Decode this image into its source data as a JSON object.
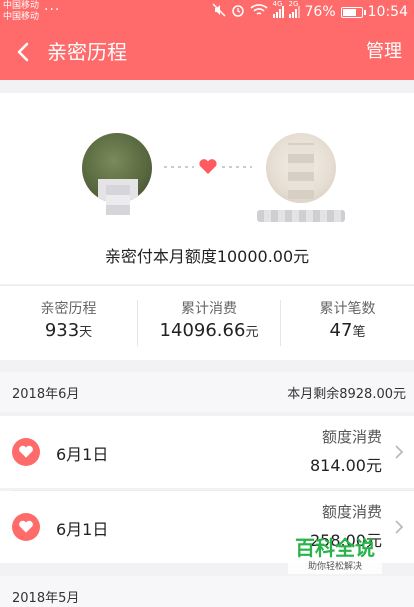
{
  "status_bar": {
    "carrier_1": "中国移动",
    "carrier_2": "中国移动",
    "more": "...",
    "network_1": "4G",
    "network_2": "2G",
    "battery": "76%",
    "battery_level": 0.76,
    "time": "10:54"
  },
  "nav": {
    "title": "亲密历程",
    "manage": "管理"
  },
  "summary": {
    "quota_text": "亲密付本月额度10000.00元"
  },
  "stats": [
    {
      "label": "亲密历程",
      "value": "933",
      "unit": "天"
    },
    {
      "label": "累计消费",
      "value": "14096.66",
      "unit": "元"
    },
    {
      "label": "累计笔数",
      "value": "47",
      "unit": "笔"
    }
  ],
  "months": [
    {
      "label": "2018年6月",
      "remaining": "本月剩余8928.00元",
      "items": [
        {
          "date": "6月1日",
          "type": "额度消费",
          "amount": "814.00元"
        },
        {
          "date": "6月1日",
          "type": "额度消费",
          "amount": "258.00元"
        }
      ]
    },
    {
      "label": "2018年5月",
      "remaining": "",
      "items": []
    }
  ],
  "watermark": {
    "title": "百科全说",
    "subtitle": "助你轻松解决"
  },
  "colors": {
    "accent": "#ff6a6a",
    "watermark_green": "#28b34a"
  }
}
